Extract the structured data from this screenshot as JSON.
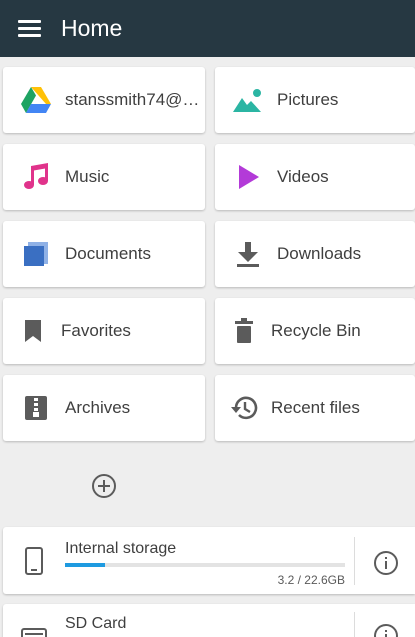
{
  "app_bar": {
    "title": "Home",
    "menu_icon": "hamburger-menu-icon"
  },
  "tiles": [
    {
      "label": "stanssmith74@…",
      "icon": "google-drive-icon"
    },
    {
      "label": "Pictures",
      "icon": "image-icon",
      "color": "#2bb5a3"
    },
    {
      "label": "Music",
      "icon": "music-note-icon",
      "color": "#e0338b"
    },
    {
      "label": "Videos",
      "icon": "play-icon",
      "color": "#b33ad8"
    },
    {
      "label": "Documents",
      "icon": "documents-icon",
      "color": "#3a6fc2"
    },
    {
      "label": "Downloads",
      "icon": "download-icon",
      "color": "#5b5b5b"
    },
    {
      "label": "Favorites",
      "icon": "bookmark-icon",
      "color": "#5b5b5b"
    },
    {
      "label": "Recycle Bin",
      "icon": "trash-icon",
      "color": "#5b5b5b"
    },
    {
      "label": "Archives",
      "icon": "archive-icon",
      "color": "#5b5b5b"
    },
    {
      "label": "Recent files",
      "icon": "history-icon",
      "color": "#5b5b5b"
    }
  ],
  "add_button_icon": "add-circle-icon",
  "storage": [
    {
      "name": "Internal storage",
      "size": "3.2 / 22.6GB",
      "used_fraction": 0.142,
      "icon": "phone-icon",
      "info_icon": "info-icon",
      "bar_color": "#1e9ae0"
    },
    {
      "name": "SD Card",
      "icon": "sd-card-icon",
      "info_icon": "info-icon"
    }
  ]
}
